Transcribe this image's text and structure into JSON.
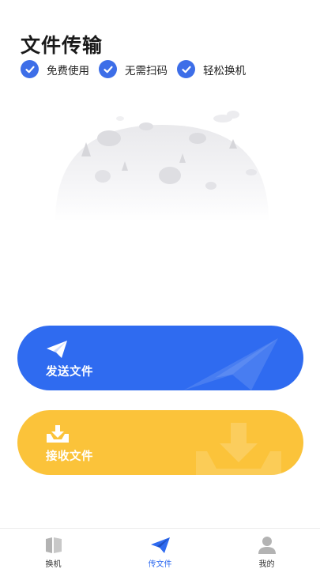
{
  "header": {
    "title": "文件传输"
  },
  "features": [
    {
      "label": "免费使用",
      "icon": "check-circle-icon"
    },
    {
      "label": "无需扫码",
      "icon": "check-circle-icon"
    },
    {
      "label": "轻松换机",
      "icon": "check-circle-icon"
    }
  ],
  "actions": {
    "send": {
      "label": "发送文件",
      "icon": "paper-plane-icon",
      "color": "#2f6bf0"
    },
    "receive": {
      "label": "接收文件",
      "icon": "download-tray-icon",
      "color": "#fbc33a"
    }
  },
  "tabbar": {
    "active": "transfer",
    "tabs": [
      {
        "id": "switch",
        "label": "换机",
        "icon": "book-icon"
      },
      {
        "id": "transfer",
        "label": "传文件",
        "icon": "paper-plane-icon"
      },
      {
        "id": "mine",
        "label": "我的",
        "icon": "user-icon"
      }
    ]
  },
  "colors": {
    "accent": "#3d6ee8",
    "inactive_icon": "#b3b3b3"
  }
}
